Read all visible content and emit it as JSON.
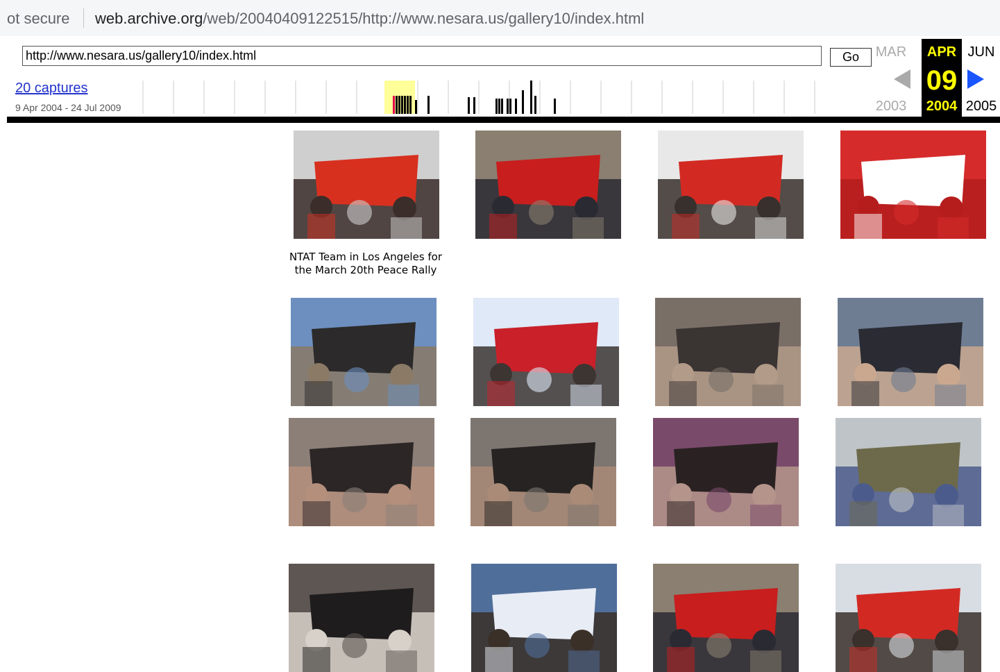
{
  "browser": {
    "security_label": "ot secure",
    "url_domain": "web.archive.org",
    "url_path": "/web/20040409122515/http://www.nesara.us/gallery10/index.html"
  },
  "wayback": {
    "url_value": "http://www.nesara.us/gallery10/index.html",
    "go_label": "Go",
    "captures_label": "20 captures",
    "date_range": "9 Apr 2004 - 24 Jul 2009",
    "prev_month": "MAR",
    "current_month": "APR",
    "next_month": "JUN",
    "current_day": "09",
    "prev_year": "2003",
    "current_year": "2004",
    "next_year": "2005",
    "accent_color": "#ffff00",
    "arrow_color": "#1a55ff"
  },
  "gallery": {
    "caption": "NTAT Team in Los Angeles for the March 20th Peace Rally",
    "photos": [
      {
        "name": "photo-group-banner",
        "palette": [
          "#cfcfcf",
          "#d8301f",
          "#3a2d2a"
        ]
      },
      {
        "name": "photo-man-handing-flyer",
        "palette": [
          "#8a7f70",
          "#c81e1e",
          "#2a2a33"
        ]
      },
      {
        "name": "photo-red-banner-street",
        "palette": [
          "#e8e8e8",
          "#d22a23",
          "#38302c"
        ]
      },
      {
        "name": "photo-banner-closeup",
        "palette": [
          "#d62b2b",
          "#ffffff",
          "#b51d1d"
        ]
      },
      {
        "name": "photo-street-crowd-palms",
        "palette": [
          "#6c8fbf",
          "#2c2a2a",
          "#8a7a66"
        ]
      },
      {
        "name": "photo-red-banner-march",
        "palette": [
          "#dfe9f7",
          "#c9202a",
          "#3d3532"
        ]
      },
      {
        "name": "photo-crowd-conversation",
        "palette": [
          "#7a6f66",
          "#3a3433",
          "#b29b89"
        ]
      },
      {
        "name": "photo-woman-flyer",
        "palette": [
          "#6f7d93",
          "#2a2b33",
          "#caa88f"
        ]
      },
      {
        "name": "photo-crowd-1",
        "palette": [
          "#8b7f78",
          "#2c2626",
          "#b48f7c"
        ]
      },
      {
        "name": "photo-crowd-2",
        "palette": [
          "#7d7670",
          "#262322",
          "#a98b77"
        ]
      },
      {
        "name": "photo-crowd-3",
        "palette": [
          "#7a4a6a",
          "#2a2222",
          "#b5958b"
        ]
      },
      {
        "name": "photo-marchers",
        "palette": [
          "#bfc4c8",
          "#6d6a4b",
          "#4b5c8c"
        ]
      },
      {
        "name": "photo-women-street",
        "palette": [
          "#5e5653",
          "#1e1c1c",
          "#d7d1c9"
        ]
      },
      {
        "name": "photo-nesara-sign",
        "palette": [
          "#4f6e9a",
          "#e8ecf4",
          "#3a3028"
        ]
      },
      {
        "name": "photo-man-handing-flyer-2",
        "palette": [
          "#8a7f70",
          "#c81e1e",
          "#2a2a33"
        ]
      },
      {
        "name": "photo-red-banner-peace",
        "palette": [
          "#d8dde3",
          "#d22a23",
          "#3a302c"
        ]
      }
    ]
  }
}
